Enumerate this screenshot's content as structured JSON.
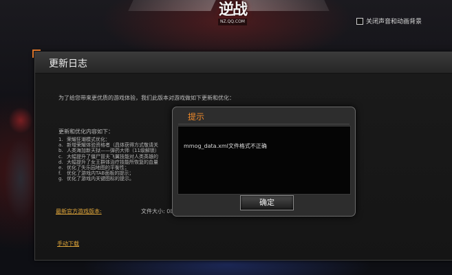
{
  "header": {
    "logo_text": "逆战",
    "logo_sub": "NZ.QQ.COM",
    "checkbox_label": "关闭声音和动画背景",
    "checkbox_checked": false
  },
  "update_log": {
    "title": "更新日志",
    "intro": "为了给您带来更优质的游戏体验，我们此版本对游戏做如下更新和优化：",
    "list_title": "更新和优化内容如下：",
    "items": [
      {
        "n": "1.",
        "text": "荣耀狂潮模式优化："
      },
      {
        "n": "a.",
        "text": "新增荣耀体验资格者（具体获得方式敬请关"
      },
      {
        "n": "b.",
        "text": "人类海加新天狱——弹药大师（11级解锁）"
      },
      {
        "n": "c.",
        "text": "大幅提升了僵尸冒夫飞翼技能对人类英雄的"
      },
      {
        "n": "d.",
        "text": "大幅提升了女王群体治疗技能所恢复的血量"
      },
      {
        "n": "e.",
        "text": "优化了失乐园地图的平衡性；"
      },
      {
        "n": "f.",
        "text": "优化了游戏内TAB面板的提示；"
      },
      {
        "n": "g.",
        "text": "优化了游戏内关键图标的提示。"
      }
    ],
    "latest_version_label": "最新官方游戏版本:",
    "file_size_label": "文件大小: 0E",
    "manual_download": "手动下载"
  },
  "dialog": {
    "title": "提示",
    "message": "mmog_data.xml文件格式不正确",
    "ok_label": "确定"
  },
  "colors": {
    "accent_orange": "#f08a2a",
    "link_gold": "#e0a63a"
  }
}
